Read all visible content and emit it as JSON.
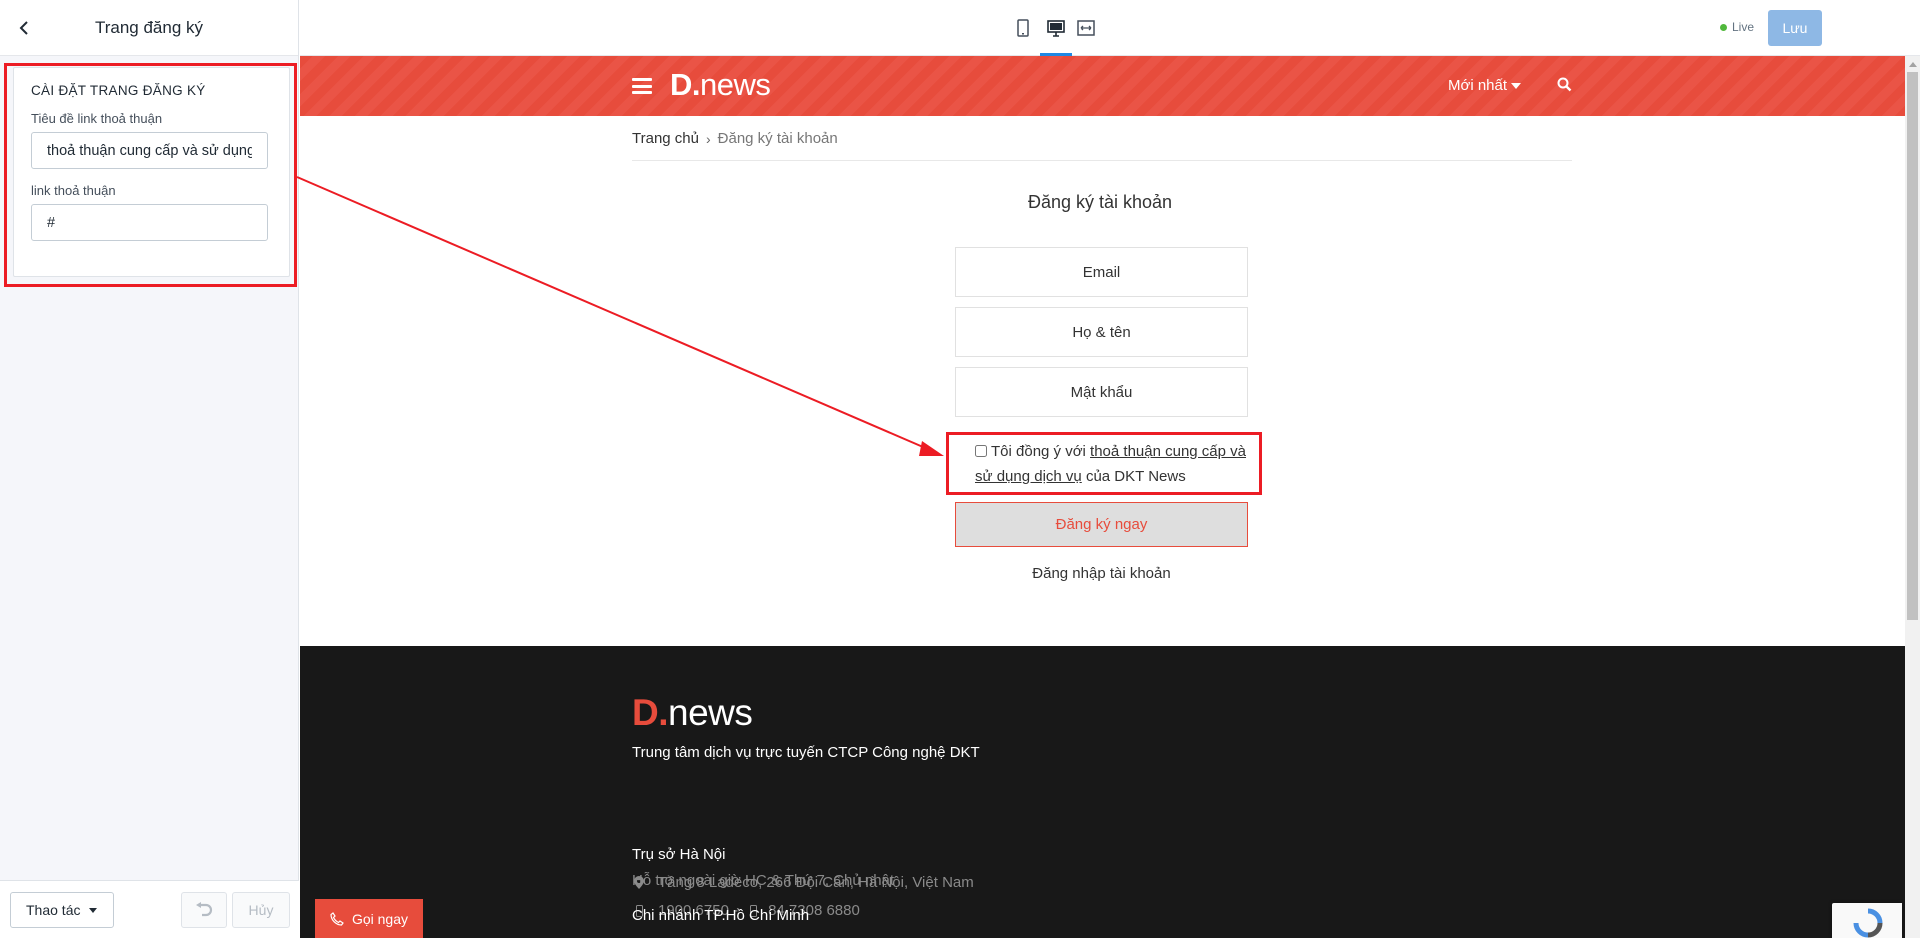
{
  "panel": {
    "title": "Trang đăng ký",
    "section_heading": "CÀI ĐẶT TRANG ĐĂNG KÝ",
    "fields": [
      {
        "label": "Tiêu đề link thoả thuận",
        "value": "thoả thuận cung cấp và sử dụng dịch vụ"
      },
      {
        "label": "link thoả thuận",
        "value": "#"
      }
    ],
    "actions_label": "Thao tác",
    "cancel_label": "Hủy"
  },
  "toolbar": {
    "devices": [
      "mobile-icon",
      "desktop-icon",
      "fullwidth-icon"
    ],
    "active_device": "desktop",
    "live_label": "Live",
    "save_label": "Lưu"
  },
  "site": {
    "logo_mark": "D.",
    "logo_text": "news",
    "nav_latest": "Mới nhất",
    "breadcrumb": [
      "Trang chủ",
      "Đăng ký tài khoản"
    ],
    "form": {
      "title": "Đăng ký tài khoản",
      "email_placeholder": "Email",
      "name_placeholder": "Họ & tên",
      "password_placeholder": "Mật khẩu",
      "agree_prefix": "Tôi đồng ý với ",
      "agree_link": "thoả thuận cung cấp và sử dụng dịch vụ",
      "agree_suffix": " của DKT News",
      "register_label": "Đăng ký ngay",
      "login_label": "Đăng nhập tài khoản"
    },
    "footer": {
      "tagline": "Trung tâm dịch vụ trực tuyến CTCP Công nghệ DKT",
      "hq_heading": "Trụ sở Hà Nội",
      "hq_address": "Tầng 8 Ladeco, 266 Đội Cấn, Hà Nội, Việt Nam",
      "hq_phone_1": "1900 6750 -",
      "hq_phone_2": "84 7308 6880",
      "hq_support": "Hỗ trợ ngoài giờ HC & Thứ 7, Chủ nhật",
      "branch_heading": "Chi nhánh TP.Hồ Chí Minh"
    },
    "call_label": "Gọi ngay"
  },
  "colors": {
    "brand_red": "#e74c3c",
    "annotation_red": "#ec1c24",
    "save_blue": "#8eb8e5",
    "footer_bg": "#181818"
  }
}
